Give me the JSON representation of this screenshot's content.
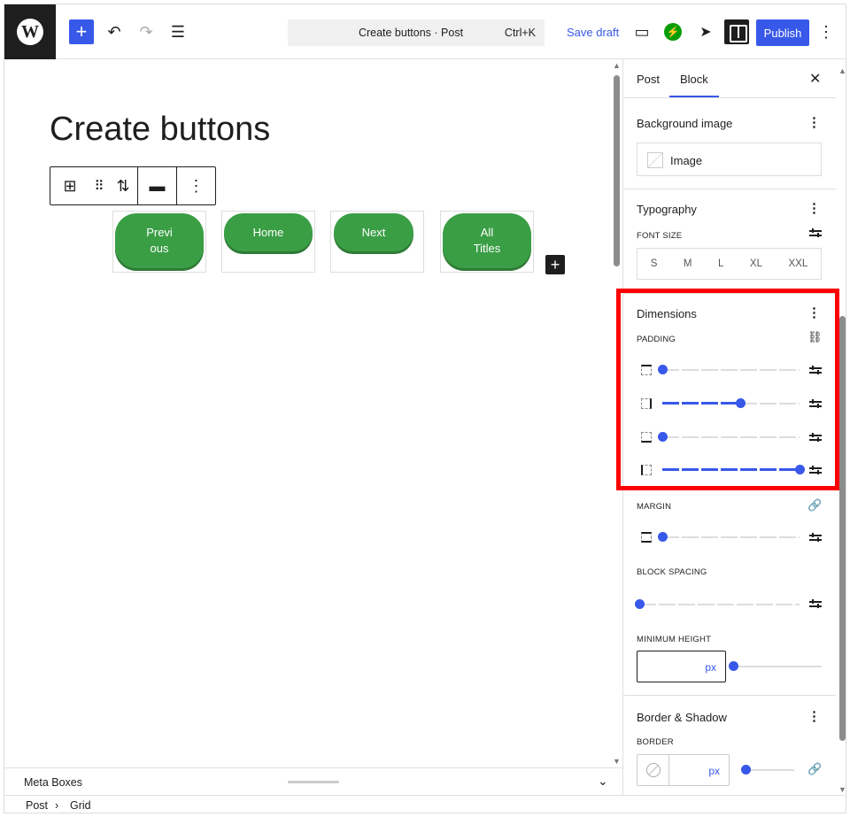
{
  "topbar": {
    "logo": "W",
    "add_icon": "+",
    "undo_icon": "↶",
    "redo_icon": "↷",
    "listview_icon": "☰",
    "command": {
      "title": "Create buttons · Post",
      "shortcut": "Ctrl+K"
    },
    "save_draft": "Save draft",
    "preview_icon": "▭",
    "jetpack_icon": "⚡",
    "send_icon": "➤",
    "publish": "Publish",
    "more_icon": "⋮"
  },
  "editor": {
    "post_title": "Create buttons",
    "toolbar": {
      "grid_icon": "⊞",
      "drag_icon": "⠿",
      "move_icon": "⇅",
      "align_icon": "▬",
      "more_icon": "⋮"
    },
    "buttons": [
      {
        "label_line1": "Previ",
        "label_line2": "ous"
      },
      {
        "label_line1": "Home",
        "label_line2": ""
      },
      {
        "label_line1": "Next",
        "label_line2": ""
      },
      {
        "label_line1": "All",
        "label_line2": "Titles"
      }
    ],
    "add_block_icon": "+"
  },
  "metabox": {
    "label": "Meta Boxes",
    "chevron": "⌄"
  },
  "breadcrumb": {
    "items": [
      "Post",
      "Grid"
    ],
    "separator": "›"
  },
  "sidebar": {
    "tabs": [
      "Post",
      "Block"
    ],
    "active_tab": "Block",
    "close_icon": "✕",
    "background_image": {
      "title": "Background image",
      "image_label": "Image"
    },
    "typography": {
      "title": "Typography",
      "font_size_label": "FONT SIZE",
      "sizes": [
        "S",
        "M",
        "L",
        "XL",
        "XXL"
      ]
    },
    "dimensions": {
      "title": "Dimensions",
      "padding_label": "PADDING",
      "padding_sliders": [
        {
          "side": "top",
          "value": 0
        },
        {
          "side": "right",
          "value": 57
        },
        {
          "side": "bottom",
          "value": 0
        },
        {
          "side": "left",
          "value": 100
        }
      ],
      "margin_label": "MARGIN",
      "margin_value": 0,
      "block_spacing_label": "BLOCK SPACING",
      "block_spacing_value": 0,
      "min_height_label": "MINIMUM HEIGHT",
      "min_height_unit": "px",
      "min_height_value": 0
    },
    "border_shadow": {
      "title": "Border & Shadow",
      "border_label": "BORDER",
      "border_unit": "px"
    }
  },
  "colors": {
    "accent": "#3858e9",
    "button_green": "#3a9e45",
    "highlight": "#ff0000",
    "dark": "#1e1e1e"
  }
}
